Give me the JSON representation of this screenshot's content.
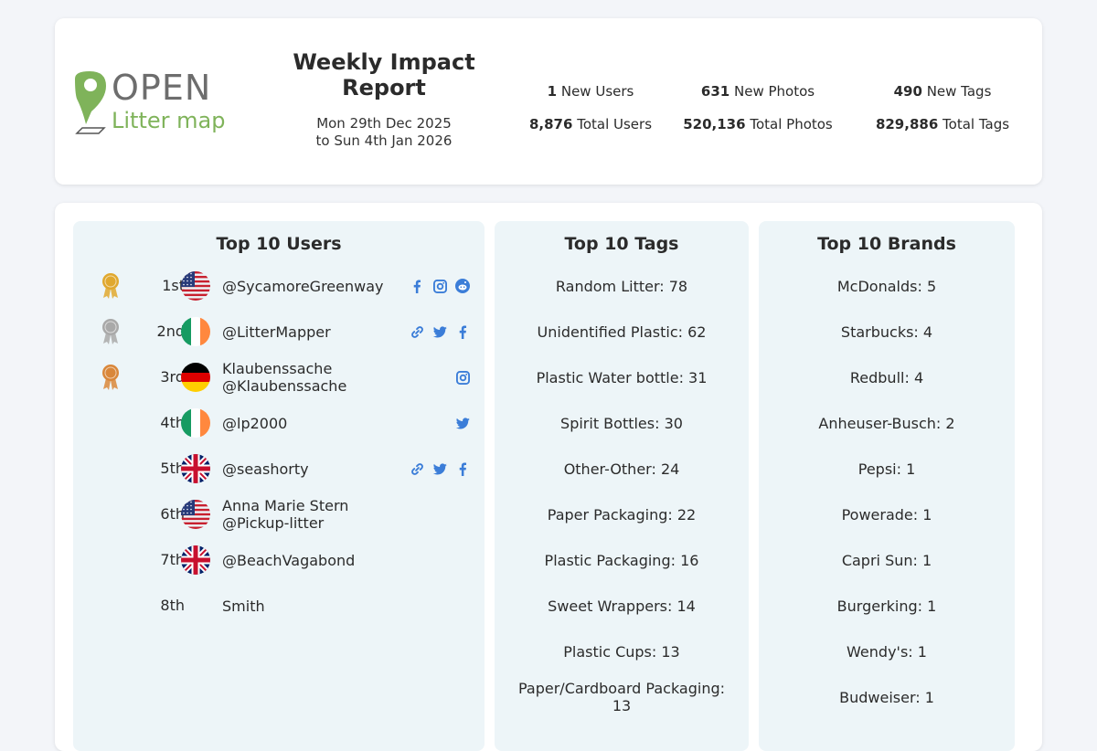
{
  "header": {
    "logo": {
      "word1": "OPEN",
      "word2": "Litter map"
    },
    "title": "Weekly Impact Report",
    "date_line1": "Mon 29th Dec 2025",
    "date_line2": "to Sun 4th Jan 2026",
    "stats": [
      {
        "value": "1",
        "label": "New Users"
      },
      {
        "value": "631",
        "label": "New Photos"
      },
      {
        "value": "490",
        "label": "New Tags"
      },
      {
        "value": "8,876",
        "label": "Total Users"
      },
      {
        "value": "520,136",
        "label": "Total Photos"
      },
      {
        "value": "829,886",
        "label": "Total Tags"
      }
    ]
  },
  "users": {
    "title": "Top 10 Users",
    "rows": [
      {
        "rank": "1st",
        "line1": "@SycamoreGreenway",
        "line2": "",
        "medal": "gold",
        "flag": "us",
        "socials": [
          "facebook-icon",
          "instagram-icon",
          "reddit-icon"
        ]
      },
      {
        "rank": "2nd",
        "line1": "@LitterMapper",
        "line2": "",
        "medal": "silver",
        "flag": "ie",
        "socials": [
          "link-icon",
          "twitter-icon",
          "facebook-icon"
        ]
      },
      {
        "rank": "3rd",
        "line1": "Klaubenssache",
        "line2": "@Klaubenssache",
        "medal": "bronze",
        "flag": "de",
        "socials": [
          "instagram-icon"
        ]
      },
      {
        "rank": "4th",
        "line1": "@lp2000",
        "line2": "",
        "medal": "",
        "flag": "ie",
        "socials": [
          "twitter-icon"
        ]
      },
      {
        "rank": "5th",
        "line1": "@seashorty",
        "line2": "",
        "medal": "",
        "flag": "gb",
        "socials": [
          "link-icon",
          "twitter-icon",
          "facebook-icon"
        ]
      },
      {
        "rank": "6th",
        "line1": "Anna Marie Stern",
        "line2": "@Pickup-litter",
        "medal": "",
        "flag": "us",
        "socials": []
      },
      {
        "rank": "7th",
        "line1": "@BeachVagabond",
        "line2": "",
        "medal": "",
        "flag": "gb",
        "socials": []
      },
      {
        "rank": "8th",
        "line1": "Smith",
        "line2": "",
        "medal": "",
        "flag": "",
        "socials": []
      }
    ]
  },
  "tags": {
    "title": "Top 10 Tags",
    "items": [
      "Random Litter: 78",
      "Unidentified Plastic: 62",
      "Plastic Water bottle: 31",
      "Spirit Bottles: 30",
      "Other-Other: 24",
      "Paper Packaging: 22",
      "Plastic Packaging: 16",
      "Sweet Wrappers: 14",
      "Plastic Cups: 13",
      "Paper/Cardboard Packaging: 13"
    ]
  },
  "brands": {
    "title": "Top 10 Brands",
    "items": [
      "McDonalds: 5",
      "Starbucks: 4",
      "Redbull: 4",
      "Anheuser-Busch: 2",
      "Pepsi: 1",
      "Powerade: 1",
      "Capri Sun: 1",
      "Burgerking: 1",
      "Wendy's: 1",
      "Budweiser: 1"
    ]
  },
  "colors": {
    "link_blue": "#3b7dd8",
    "gold": "#e0a82e",
    "silver": "#a9a9a9",
    "bronze": "#d9873a",
    "logo_green": "#7fb35a",
    "logo_gray": "#6d6d6d"
  }
}
